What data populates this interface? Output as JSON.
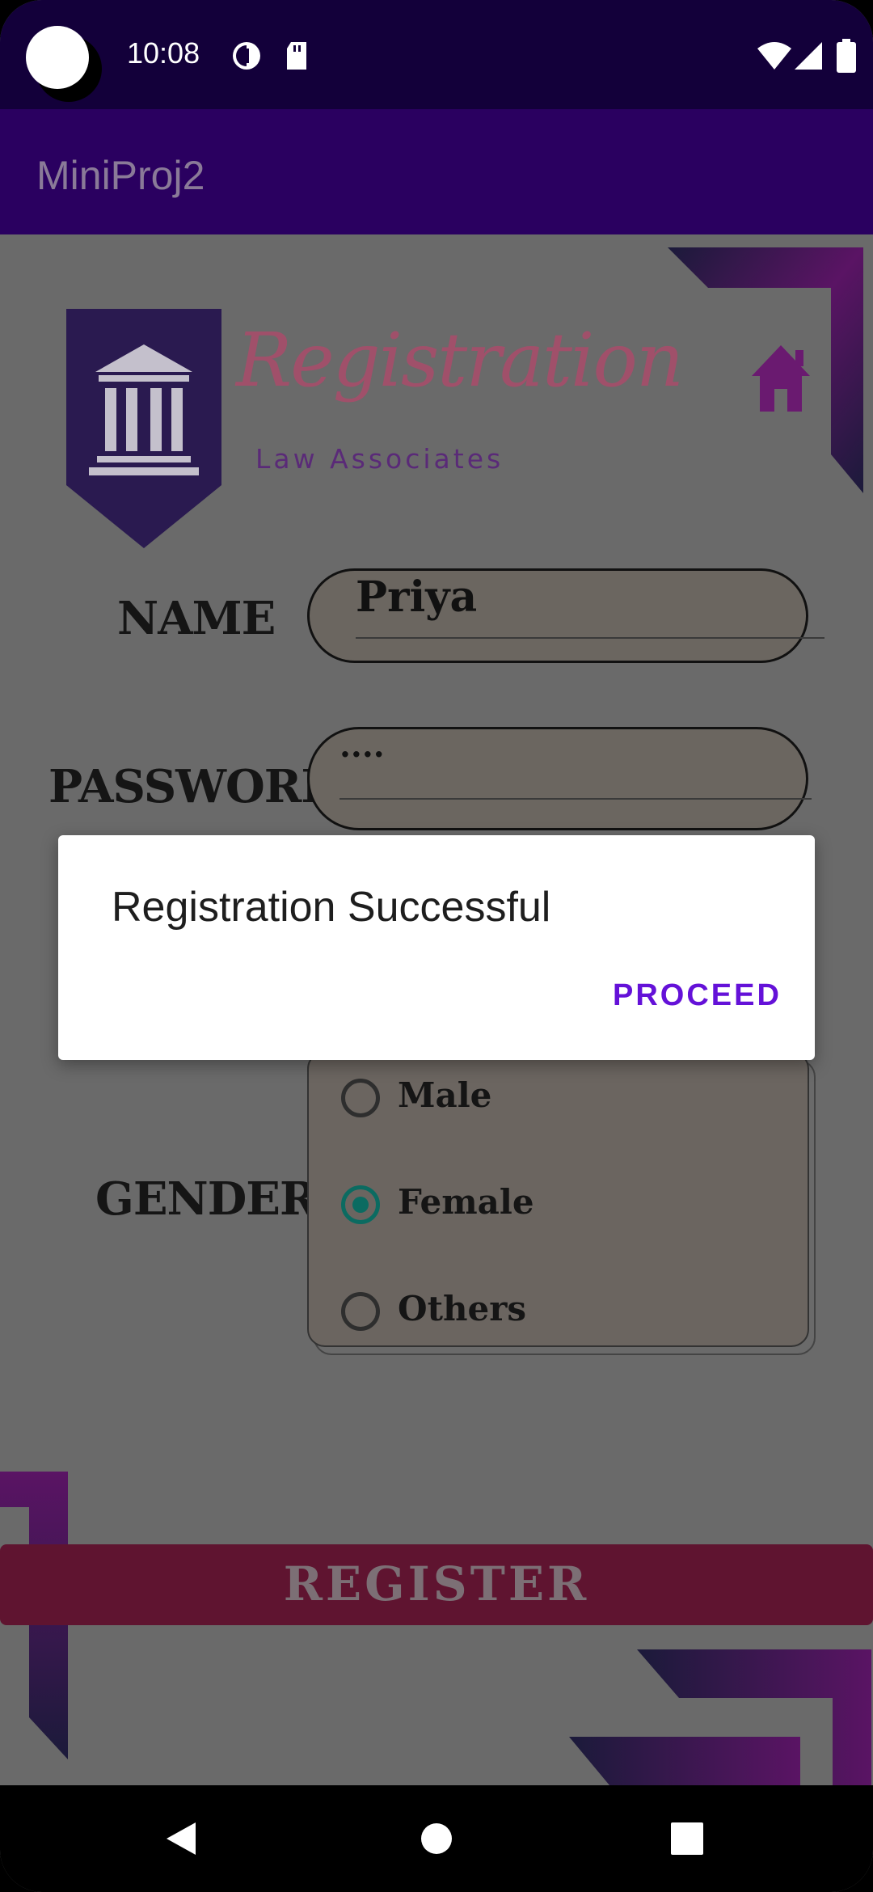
{
  "status_bar": {
    "time": "10:08",
    "icons": [
      "data-saver-icon",
      "sd-card-icon",
      "wifi-icon",
      "signal-icon",
      "battery-icon"
    ]
  },
  "app_bar": {
    "title": "MiniProj2"
  },
  "header": {
    "title": "Registration",
    "subtitle": "Law Associates",
    "logo": "courthouse-icon",
    "home_icon": "home-icon"
  },
  "form": {
    "name": {
      "label": "NAME",
      "value": "Priya"
    },
    "password": {
      "label": "PASSWORD",
      "value": "····"
    },
    "gender": {
      "label": "GENDER",
      "options": [
        {
          "label": "Male",
          "checked": false
        },
        {
          "label": "Female",
          "checked": true
        },
        {
          "label": "Others",
          "checked": false
        }
      ]
    },
    "register_label": "REGISTER"
  },
  "dialog": {
    "title": "Registration Successful",
    "button_label": "PROCEED"
  },
  "nav_bar": {
    "icons": [
      "back-icon",
      "home-nav-icon",
      "recents-icon"
    ]
  },
  "colors": {
    "status_bar": "#13003a",
    "app_bar": "#2a0060",
    "accent": "#6411d8",
    "register": "#5f1430",
    "radio_checked": "#0b6b61"
  }
}
